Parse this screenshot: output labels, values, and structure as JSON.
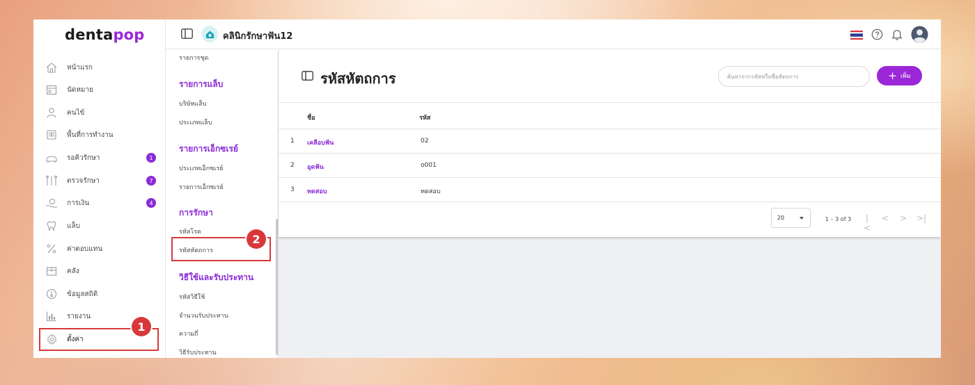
{
  "brand": {
    "logo_dark": "denta",
    "logo_accent": "pop"
  },
  "header": {
    "clinic_name": "คลินิกรักษาฟัน12"
  },
  "sidebar": {
    "items": [
      {
        "label": "หน้าแรก",
        "icon": "home-icon"
      },
      {
        "label": "นัดหมาย",
        "icon": "calendar-icon"
      },
      {
        "label": "คนไข้",
        "icon": "user-icon"
      },
      {
        "label": "พื้นที่การทำงาน",
        "icon": "workspace-icon"
      },
      {
        "label": "รอคิวรักษา",
        "icon": "dental-chair-icon",
        "badge": "1"
      },
      {
        "label": "ตรวจรักษา",
        "icon": "dental-tools-icon",
        "badge": "7"
      },
      {
        "label": "การเงิน",
        "icon": "payment-icon",
        "badge": "4"
      },
      {
        "label": "แล็บ",
        "icon": "tooth-icon"
      },
      {
        "label": "ค่าตอบแทน",
        "icon": "percent-icon"
      },
      {
        "label": "คลัง",
        "icon": "inventory-icon"
      },
      {
        "label": "ข้อมูลสถิติ",
        "icon": "statistics-icon"
      },
      {
        "label": "รายงาน",
        "icon": "report-icon"
      },
      {
        "label": "ตั้งค่า",
        "icon": "gear-icon"
      }
    ]
  },
  "submenu": {
    "top_item": "รายการชุด",
    "lab_heading": "รายการแล็บ",
    "lab_items": [
      "บริษัทแล็บ",
      "ประเภทแล็บ"
    ],
    "xray_heading": "รายการเอ็กซเรย์",
    "xray_items": [
      "ประเภทเอ็กซเรย์",
      "รายการเอ็กซเรย์"
    ],
    "treatment_heading": "การรักษา",
    "treatment_items": [
      "รหัสโรค",
      "รหัสหัตถการ"
    ],
    "drug_heading": "วิธีใช้และรับประทาน",
    "drug_items": [
      "รหัสวิธีใช้",
      "จำนวนรับประทาน",
      "ความถี่",
      "วิธีรับประทาน"
    ]
  },
  "steps": {
    "one": "1",
    "two": "2"
  },
  "page": {
    "title": "รหัสหัตถการ",
    "search_placeholder": "ค้นหาจากรหัสหรือชื่อหัตถการ",
    "add_label": "เพิ่ม",
    "columns": {
      "name": "ชื่อ",
      "code": "รหัส"
    },
    "rows": [
      {
        "index": "1",
        "name": "เคลือบฟัน",
        "code": "02"
      },
      {
        "index": "2",
        "name": "อุดฟัน",
        "code": "o001"
      },
      {
        "index": "3",
        "name": "ทดสอบ",
        "code": "ทดสอบ"
      }
    ],
    "pagination": {
      "page_size": "20",
      "range": "1 – 3 of 3"
    }
  },
  "colors": {
    "accent": "#9b27d8",
    "highlight": "#d8383a"
  }
}
